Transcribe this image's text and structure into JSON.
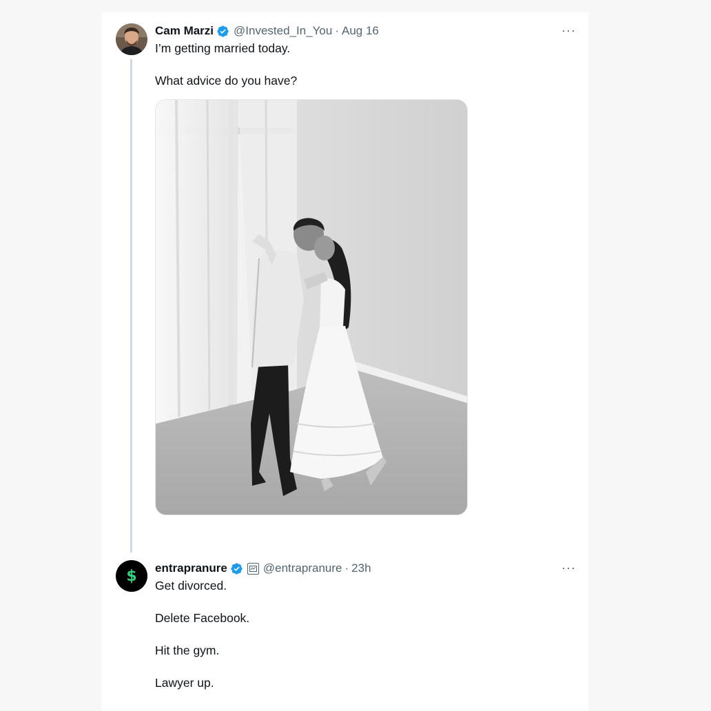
{
  "tweets": [
    {
      "author_name": "Cam Marzi",
      "handle": "@Invested_In_You",
      "separator": "·",
      "timestamp": "Aug 16",
      "verified": true,
      "lines": [
        "I’m getting married today.",
        "What advice do you have?"
      ],
      "avatar_icon": "profile-photo-man",
      "media_icon": "black-and-white-photo-couple-kissing"
    },
    {
      "author_name": "entrapranure",
      "handle": "@entrapranure",
      "separator": "·",
      "timestamp": "23h",
      "verified": true,
      "affiliation_icon": "affiliate-badge-icon",
      "avatar_glyph": "$",
      "lines": [
        "Get divorced.",
        "Delete Facebook.",
        "Hit the gym.",
        "Lawyer up."
      ]
    }
  ],
  "more_label": "···",
  "colors": {
    "verified": "#1d9bf0",
    "secondary_text": "#536471",
    "thread_line": "#cfd9de",
    "dollar_green": "#35d07f"
  }
}
